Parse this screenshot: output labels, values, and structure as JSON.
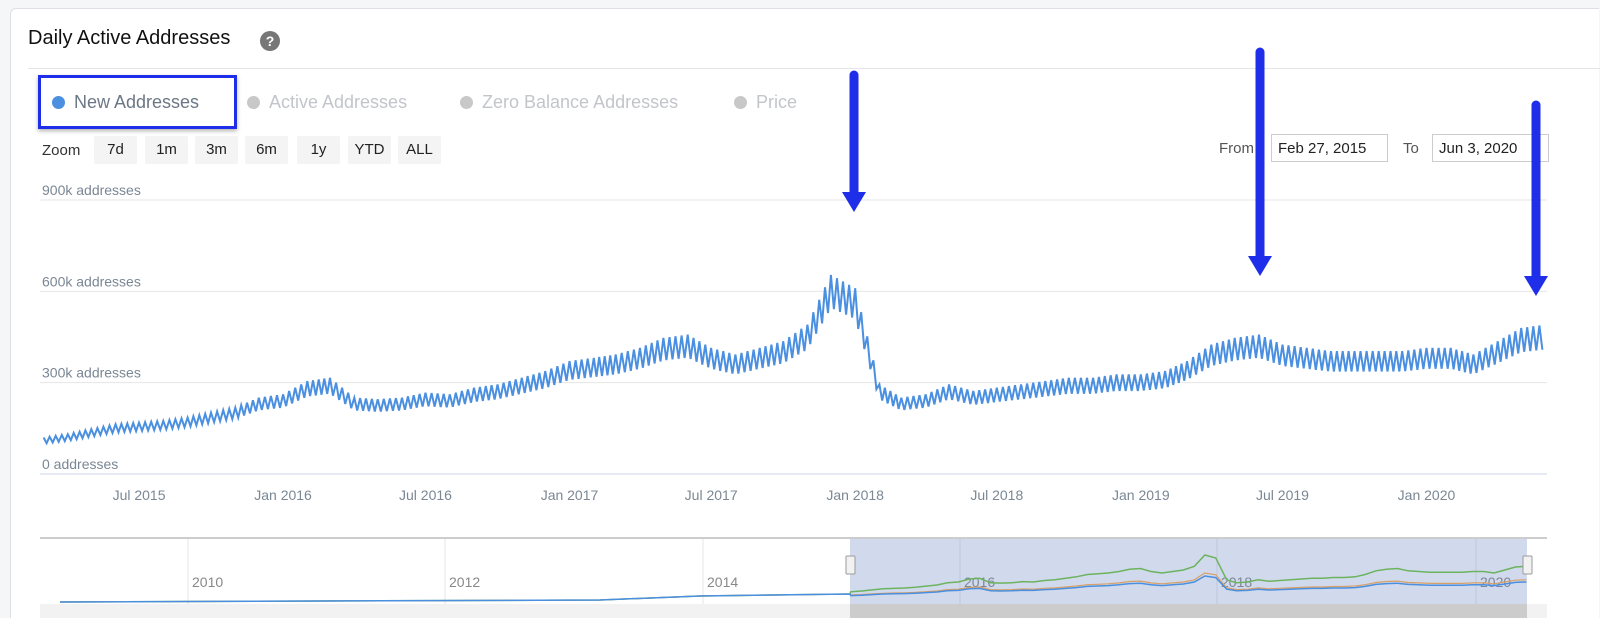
{
  "header": {
    "title": "Daily Active Addresses",
    "help_icon": "question-circle-icon"
  },
  "legend": [
    {
      "label": "New Addresses",
      "active": true,
      "color": "#4a8fe0"
    },
    {
      "label": "Active Addresses",
      "active": false
    },
    {
      "label": "Zero Balance Addresses",
      "active": false
    },
    {
      "label": "Price",
      "active": false
    }
  ],
  "zoom": {
    "label": "Zoom",
    "buttons": [
      "7d",
      "1m",
      "3m",
      "6m",
      "1y",
      "YTD",
      "ALL"
    ]
  },
  "range": {
    "from_label": "From",
    "from_value": "Feb 27, 2015",
    "to_label": "To",
    "to_value": "Jun 3, 2020"
  },
  "navigator": {
    "labels": [
      "2010",
      "2012",
      "2014",
      "2016",
      "2018",
      "2020"
    ]
  },
  "colors": {
    "line": "#4a8fe0",
    "annotation": "#1f2ee8"
  },
  "chart_data": {
    "type": "line",
    "title": "Daily Active Addresses",
    "series": [
      {
        "name": "New Addresses",
        "color": "#4a8fe0"
      }
    ],
    "xlim": [
      "2015-02-27",
      "2020-06-03"
    ],
    "ylim": [
      0,
      900000
    ],
    "yticks": [
      {
        "value": 0,
        "label": "0 addresses"
      },
      {
        "value": 300000,
        "label": "300k addresses"
      },
      {
        "value": 600000,
        "label": "600k addresses"
      },
      {
        "value": 900000,
        "label": "900k addresses"
      }
    ],
    "xticks": [
      {
        "date": "2015-07-01",
        "label": "Jul 2015"
      },
      {
        "date": "2016-01-01",
        "label": "Jan 2016"
      },
      {
        "date": "2016-07-01",
        "label": "Jul 2016"
      },
      {
        "date": "2017-01-01",
        "label": "Jan 2017"
      },
      {
        "date": "2017-07-01",
        "label": "Jul 2017"
      },
      {
        "date": "2018-01-01",
        "label": "Jan 2018"
      },
      {
        "date": "2018-07-01",
        "label": "Jul 2018"
      },
      {
        "date": "2019-01-01",
        "label": "Jan 2019"
      },
      {
        "date": "2019-07-01",
        "label": "Jul 2019"
      },
      {
        "date": "2020-01-01",
        "label": "Jan 2020"
      }
    ],
    "grid": true,
    "points": [
      [
        "2015-03",
        110000
      ],
      [
        "2015-04",
        120000
      ],
      [
        "2015-05",
        135000
      ],
      [
        "2015-06",
        150000
      ],
      [
        "2015-07",
        155000
      ],
      [
        "2015-08",
        160000
      ],
      [
        "2015-09",
        170000
      ],
      [
        "2015-10",
        185000
      ],
      [
        "2015-11",
        200000
      ],
      [
        "2015-12",
        230000
      ],
      [
        "2016-01",
        240000
      ],
      [
        "2016-02",
        280000
      ],
      [
        "2016-03",
        290000
      ],
      [
        "2016-04",
        230000
      ],
      [
        "2016-05",
        225000
      ],
      [
        "2016-06",
        230000
      ],
      [
        "2016-07",
        245000
      ],
      [
        "2016-08",
        240000
      ],
      [
        "2016-09",
        260000
      ],
      [
        "2016-10",
        270000
      ],
      [
        "2016-11",
        290000
      ],
      [
        "2016-12",
        310000
      ],
      [
        "2017-01",
        340000
      ],
      [
        "2017-02",
        350000
      ],
      [
        "2017-03",
        360000
      ],
      [
        "2017-04",
        380000
      ],
      [
        "2017-05",
        410000
      ],
      [
        "2017-06",
        420000
      ],
      [
        "2017-07",
        380000
      ],
      [
        "2017-08",
        360000
      ],
      [
        "2017-09",
        380000
      ],
      [
        "2017-10",
        400000
      ],
      [
        "2017-11",
        450000
      ],
      [
        "2017-12",
        600000
      ],
      [
        "2018-01",
        560000
      ],
      [
        "2018-02",
        270000
      ],
      [
        "2018-03",
        230000
      ],
      [
        "2018-04",
        240000
      ],
      [
        "2018-05",
        270000
      ],
      [
        "2018-06",
        250000
      ],
      [
        "2018-07",
        260000
      ],
      [
        "2018-08",
        270000
      ],
      [
        "2018-09",
        280000
      ],
      [
        "2018-10",
        290000
      ],
      [
        "2018-11",
        290000
      ],
      [
        "2018-12",
        300000
      ],
      [
        "2019-01",
        300000
      ],
      [
        "2019-02",
        310000
      ],
      [
        "2019-03",
        340000
      ],
      [
        "2019-04",
        390000
      ],
      [
        "2019-05",
        410000
      ],
      [
        "2019-06",
        420000
      ],
      [
        "2019-07",
        390000
      ],
      [
        "2019-08",
        380000
      ],
      [
        "2019-09",
        370000
      ],
      [
        "2019-10",
        370000
      ],
      [
        "2019-11",
        370000
      ],
      [
        "2019-12",
        370000
      ],
      [
        "2020-01",
        380000
      ],
      [
        "2020-02",
        380000
      ],
      [
        "2020-03",
        360000
      ],
      [
        "2020-04",
        400000
      ],
      [
        "2020-05",
        440000
      ],
      [
        "2020-06",
        450000
      ]
    ],
    "annotations": [
      {
        "type": "arrow",
        "date": "2018-01-01"
      },
      {
        "type": "arrow",
        "date": "2019-06-15"
      },
      {
        "type": "arrow",
        "date": "2020-05-25"
      }
    ]
  }
}
